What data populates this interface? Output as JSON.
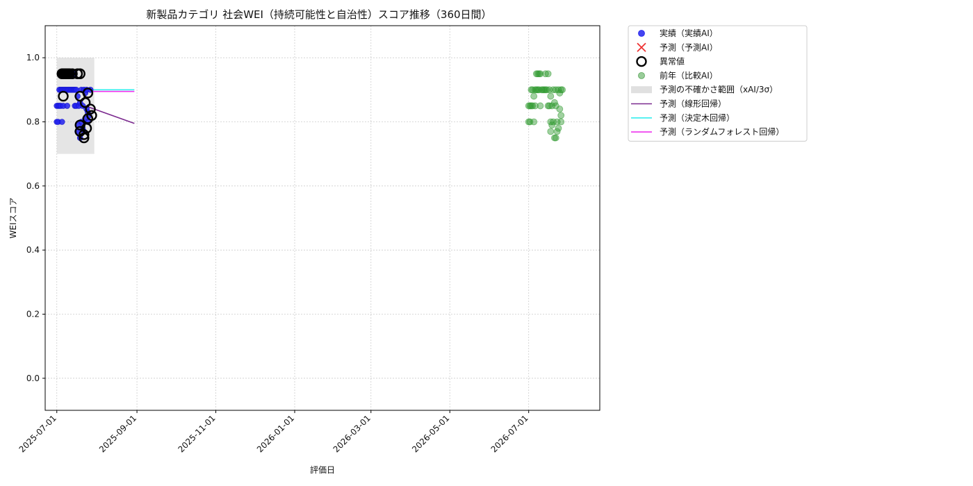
{
  "chart_data": {
    "type": "scatter",
    "title": "新製品カテゴリ 社会WEI（持続可能性と自治性）スコア推移（360日間）",
    "xlabel": "評価日",
    "ylabel": "WEIスコア",
    "xlim": [
      "2025-06-22",
      "2026-08-25"
    ],
    "ylim": [
      -0.1,
      1.1
    ],
    "x_ticks": [
      "2025-07-01",
      "2025-09-01",
      "2025-11-01",
      "2026-01-01",
      "2026-03-01",
      "2026-05-01",
      "2026-07-01"
    ],
    "y_ticks": [
      0.0,
      0.2,
      0.4,
      0.6,
      0.8,
      1.0
    ],
    "y_tick_labels": [
      "0.0",
      "0.2",
      "0.4",
      "0.6",
      "0.8",
      "1.0"
    ],
    "grid": true,
    "legend_position": "outside-top-right",
    "legend": [
      {
        "label": "実績（実績AI）",
        "kind": "dot",
        "color": "#2222ee"
      },
      {
        "label": "予測（予測AI）",
        "kind": "cross",
        "color": "#ee3333"
      },
      {
        "label": "異常値",
        "kind": "ring",
        "color": "#000000"
      },
      {
        "label": "前年（比較AI）",
        "kind": "dot",
        "color": "#7fbf7f"
      },
      {
        "label": "予測の不確かさ範囲（xAI/3σ）",
        "kind": "band",
        "color": "#cccccc"
      },
      {
        "label": "予測（線形回帰）",
        "kind": "line",
        "color": "#7b2a8f"
      },
      {
        "label": "予測（決定木回帰）",
        "kind": "line",
        "color": "#33eeee"
      },
      {
        "label": "予測（ランダムフォレスト回帰）",
        "kind": "line",
        "color": "#ee33ee"
      }
    ],
    "uncertainty_band": {
      "x": [
        "2025-07-01",
        "2025-07-30"
      ],
      "y": [
        0.7,
        1.0
      ]
    },
    "series": [
      {
        "kind": "actual",
        "color": "#2222ee",
        "points": [
          {
            "x": "2025-07-01",
            "y": 0.85
          },
          {
            "x": "2025-07-01",
            "y": 0.8
          },
          {
            "x": "2025-07-02",
            "y": 0.85
          },
          {
            "x": "2025-07-02",
            "y": 0.8
          },
          {
            "x": "2025-07-03",
            "y": 0.85
          },
          {
            "x": "2025-07-03",
            "y": 0.9
          },
          {
            "x": "2025-07-04",
            "y": 0.85
          },
          {
            "x": "2025-07-04",
            "y": 0.9
          },
          {
            "x": "2025-07-04",
            "y": 0.95
          },
          {
            "x": "2025-07-05",
            "y": 0.8
          },
          {
            "x": "2025-07-05",
            "y": 0.9
          },
          {
            "x": "2025-07-05",
            "y": 0.95
          },
          {
            "x": "2025-07-06",
            "y": 0.85
          },
          {
            "x": "2025-07-06",
            "y": 0.9
          },
          {
            "x": "2025-07-06",
            "y": 0.95
          },
          {
            "x": "2025-07-07",
            "y": 0.9
          },
          {
            "x": "2025-07-07",
            "y": 0.95
          },
          {
            "x": "2025-07-08",
            "y": 0.9
          },
          {
            "x": "2025-07-08",
            "y": 0.95
          },
          {
            "x": "2025-07-09",
            "y": 0.85
          },
          {
            "x": "2025-07-09",
            "y": 0.9
          },
          {
            "x": "2025-07-09",
            "y": 0.95
          },
          {
            "x": "2025-07-10",
            "y": 0.9
          },
          {
            "x": "2025-07-10",
            "y": 0.95
          },
          {
            "x": "2025-07-11",
            "y": 0.9
          },
          {
            "x": "2025-07-11",
            "y": 0.95
          },
          {
            "x": "2025-07-12",
            "y": 0.9
          },
          {
            "x": "2025-07-12",
            "y": 0.95
          },
          {
            "x": "2025-07-13",
            "y": 0.9
          },
          {
            "x": "2025-07-13",
            "y": 0.95
          },
          {
            "x": "2025-07-14",
            "y": 0.9
          },
          {
            "x": "2025-07-14",
            "y": 0.95
          },
          {
            "x": "2025-07-15",
            "y": 0.9
          },
          {
            "x": "2025-07-15",
            "y": 0.85
          },
          {
            "x": "2025-07-16",
            "y": 0.9
          },
          {
            "x": "2025-07-16",
            "y": 0.85
          },
          {
            "x": "2025-07-17",
            "y": 0.88
          },
          {
            "x": "2025-07-17",
            "y": 0.77
          },
          {
            "x": "2025-07-18",
            "y": 0.85
          },
          {
            "x": "2025-07-18",
            "y": 0.79
          },
          {
            "x": "2025-07-19",
            "y": 0.75
          },
          {
            "x": "2025-07-19",
            "y": 0.86
          },
          {
            "x": "2025-07-20",
            "y": 0.9
          },
          {
            "x": "2025-07-20",
            "y": 0.8
          },
          {
            "x": "2025-07-21",
            "y": 0.85
          },
          {
            "x": "2025-07-21",
            "y": 0.78
          },
          {
            "x": "2025-07-22",
            "y": 0.9
          },
          {
            "x": "2025-07-22",
            "y": 0.77
          },
          {
            "x": "2025-07-23",
            "y": 0.89
          },
          {
            "x": "2025-07-23",
            "y": 0.81
          },
          {
            "x": "2025-07-24",
            "y": 0.84
          },
          {
            "x": "2025-07-24",
            "y": 0.9
          },
          {
            "x": "2025-07-25",
            "y": 0.83
          },
          {
            "x": "2025-07-25",
            "y": 0.8
          },
          {
            "x": "2025-07-26",
            "y": 0.82
          },
          {
            "x": "2025-07-27",
            "y": 0.9
          }
        ]
      },
      {
        "kind": "anomaly",
        "color": "#000000",
        "points": [
          {
            "x": "2025-07-05",
            "y": 0.95
          },
          {
            "x": "2025-07-06",
            "y": 0.95
          },
          {
            "x": "2025-07-07",
            "y": 0.95
          },
          {
            "x": "2025-07-08",
            "y": 0.95
          },
          {
            "x": "2025-07-09",
            "y": 0.95
          },
          {
            "x": "2025-07-10",
            "y": 0.95
          },
          {
            "x": "2025-07-11",
            "y": 0.95
          },
          {
            "x": "2025-07-13",
            "y": 0.95
          },
          {
            "x": "2025-07-17",
            "y": 0.95
          },
          {
            "x": "2025-07-19",
            "y": 0.95
          },
          {
            "x": "2025-07-06",
            "y": 0.88
          },
          {
            "x": "2025-07-19",
            "y": 0.88
          },
          {
            "x": "2025-07-25",
            "y": 0.89
          },
          {
            "x": "2025-07-23",
            "y": 0.86
          },
          {
            "x": "2025-07-27",
            "y": 0.84
          },
          {
            "x": "2025-07-28",
            "y": 0.82
          },
          {
            "x": "2025-07-19",
            "y": 0.79
          },
          {
            "x": "2025-07-25",
            "y": 0.81
          },
          {
            "x": "2025-07-19",
            "y": 0.77
          },
          {
            "x": "2025-07-24",
            "y": 0.78
          },
          {
            "x": "2025-07-22",
            "y": 0.76
          },
          {
            "x": "2025-07-22",
            "y": 0.75
          }
        ]
      },
      {
        "kind": "previous_year",
        "color": "#2f9a2f",
        "points": [
          {
            "x": "2026-07-01",
            "y": 0.85
          },
          {
            "x": "2026-07-01",
            "y": 0.8
          },
          {
            "x": "2026-07-02",
            "y": 0.85
          },
          {
            "x": "2026-07-02",
            "y": 0.8
          },
          {
            "x": "2026-07-03",
            "y": 0.85
          },
          {
            "x": "2026-07-03",
            "y": 0.9
          },
          {
            "x": "2026-07-04",
            "y": 0.85
          },
          {
            "x": "2026-07-04",
            "y": 0.9
          },
          {
            "x": "2026-07-05",
            "y": 0.88
          },
          {
            "x": "2026-07-05",
            "y": 0.8
          },
          {
            "x": "2026-07-06",
            "y": 0.85
          },
          {
            "x": "2026-07-06",
            "y": 0.9
          },
          {
            "x": "2026-07-07",
            "y": 0.95
          },
          {
            "x": "2026-07-07",
            "y": 0.9
          },
          {
            "x": "2026-07-08",
            "y": 0.95
          },
          {
            "x": "2026-07-08",
            "y": 0.9
          },
          {
            "x": "2026-07-09",
            "y": 0.95
          },
          {
            "x": "2026-07-09",
            "y": 0.9
          },
          {
            "x": "2026-07-10",
            "y": 0.95
          },
          {
            "x": "2026-07-10",
            "y": 0.85
          },
          {
            "x": "2026-07-11",
            "y": 0.9
          },
          {
            "x": "2026-07-12",
            "y": 0.9
          },
          {
            "x": "2026-07-13",
            "y": 0.9
          },
          {
            "x": "2026-07-14",
            "y": 0.9
          },
          {
            "x": "2026-07-14",
            "y": 0.95
          },
          {
            "x": "2026-07-15",
            "y": 0.9
          },
          {
            "x": "2026-07-16",
            "y": 0.95
          },
          {
            "x": "2026-07-16",
            "y": 0.85
          },
          {
            "x": "2026-07-17",
            "y": 0.9
          },
          {
            "x": "2026-07-17",
            "y": 0.85
          },
          {
            "x": "2026-07-18",
            "y": 0.88
          },
          {
            "x": "2026-07-18",
            "y": 0.8
          },
          {
            "x": "2026-07-18",
            "y": 0.77
          },
          {
            "x": "2026-07-19",
            "y": 0.85
          },
          {
            "x": "2026-07-19",
            "y": 0.79
          },
          {
            "x": "2026-07-20",
            "y": 0.9
          },
          {
            "x": "2026-07-20",
            "y": 0.8
          },
          {
            "x": "2026-07-21",
            "y": 0.75
          },
          {
            "x": "2026-07-21",
            "y": 0.86
          },
          {
            "x": "2026-07-22",
            "y": 0.9
          },
          {
            "x": "2026-07-22",
            "y": 0.75
          },
          {
            "x": "2026-07-22",
            "y": 0.85
          },
          {
            "x": "2026-07-23",
            "y": 0.8
          },
          {
            "x": "2026-07-23",
            "y": 0.77
          },
          {
            "x": "2026-07-24",
            "y": 0.9
          },
          {
            "x": "2026-07-24",
            "y": 0.78
          },
          {
            "x": "2026-07-25",
            "y": 0.89
          },
          {
            "x": "2026-07-25",
            "y": 0.84
          },
          {
            "x": "2026-07-26",
            "y": 0.9
          },
          {
            "x": "2026-07-26",
            "y": 0.8
          },
          {
            "x": "2026-07-26",
            "y": 0.82
          },
          {
            "x": "2026-07-27",
            "y": 0.9
          }
        ]
      }
    ],
    "forecast_lines": [
      {
        "kind": "linear",
        "color": "#7b2a8f",
        "points": [
          {
            "x": "2025-07-23",
            "y": 0.85
          },
          {
            "x": "2025-08-30",
            "y": 0.795
          }
        ]
      },
      {
        "kind": "decision_tree",
        "color": "#33eeee",
        "points": [
          {
            "x": "2025-07-23",
            "y": 0.9
          },
          {
            "x": "2025-08-30",
            "y": 0.9
          }
        ]
      },
      {
        "kind": "random_forest",
        "color": "#ee33ee",
        "points": [
          {
            "x": "2025-07-23",
            "y": 0.895
          },
          {
            "x": "2025-08-30",
            "y": 0.895
          }
        ]
      }
    ]
  }
}
